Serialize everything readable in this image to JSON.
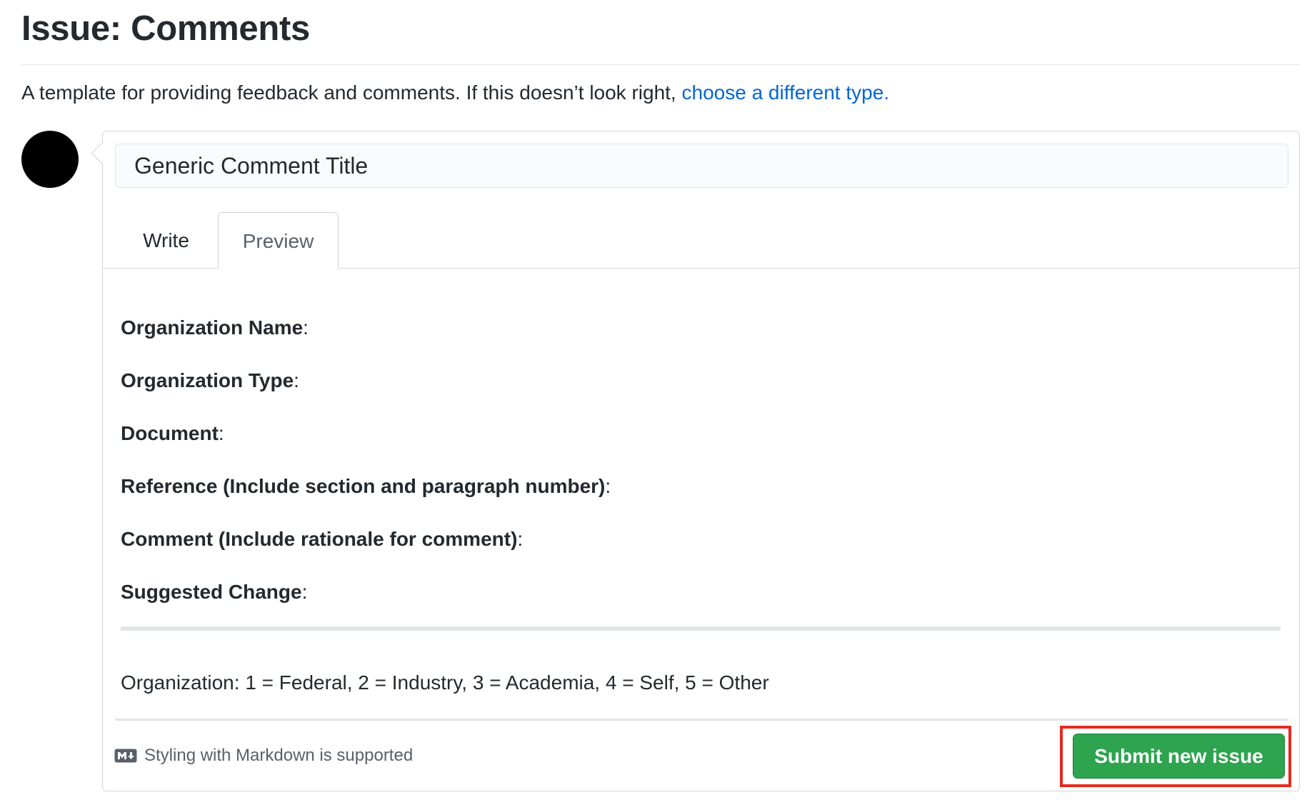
{
  "page_title": "Issue: Comments",
  "description": {
    "text": "A template for providing feedback and comments. If this doesn’t look right,",
    "link": "choose a different type."
  },
  "form": {
    "title_value": "Generic Comment Title",
    "tabs": [
      {
        "label": "Write",
        "active": false
      },
      {
        "label": "Preview",
        "active": true
      }
    ],
    "preview": {
      "fields": [
        "Organization Name",
        "Organization Type",
        "Document",
        "Reference (Include section and paragraph number)",
        "Comment (Include rationale for comment)",
        "Suggested Change"
      ],
      "field_suffix": ":",
      "organization_legend": "Organization: 1 = Federal, 2 = Industry, 3 = Academia, 4 = Self, 5 = Other"
    },
    "footer": {
      "markdown_note": "Styling with Markdown is supported",
      "submit_label": "Submit new issue"
    }
  },
  "colors": {
    "submit_green": "#2ea44f",
    "link_blue": "#0366d6",
    "highlight_red": "#e32b20",
    "avatar": "#000000"
  },
  "icons": {
    "avatar": "user-avatar",
    "markdown": "markdown-icon"
  }
}
